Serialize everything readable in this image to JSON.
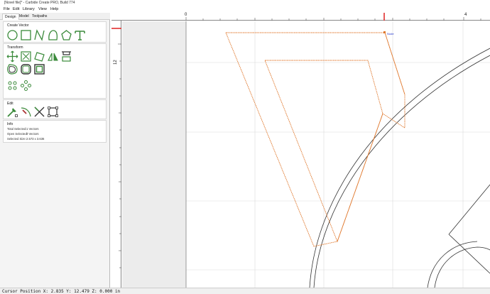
{
  "window": {
    "title": "[Novel file]* - Carbide Create PRO, Build 774"
  },
  "menu": [
    {
      "label": "File"
    },
    {
      "label": "Edit"
    },
    {
      "label": "Library"
    },
    {
      "label": "View"
    },
    {
      "label": "Help"
    }
  ],
  "tabs": [
    {
      "label": "Design",
      "active": true
    },
    {
      "label": "Model",
      "active": false
    },
    {
      "label": "Toolpaths",
      "active": false
    }
  ],
  "sections": {
    "create_vector": {
      "title": "Create Vector",
      "tools": [
        "circle-icon",
        "rectangle-icon",
        "polyline-icon",
        "curve-icon",
        "polygon-icon",
        "text-icon"
      ]
    },
    "transform": {
      "title": "Transform",
      "tools": [
        "move-icon",
        "scale-icon",
        "rotate-icon",
        "mirror-icon",
        "align-icon",
        "offset-icon",
        "fillet-icon",
        "boolean-icon",
        "circular-array-icon",
        "linear-array-icon"
      ]
    },
    "edit": {
      "title": "Edit",
      "tools": [
        "node-edit-icon",
        "knife-icon",
        "trim-icon",
        "bounding-box-icon"
      ]
    },
    "info": {
      "title": "Info",
      "rows": [
        {
          "label": "Total Selected:",
          "value": "1 Vectors"
        },
        {
          "label": "Open Selected:",
          "value": "0 Vectors"
        },
        {
          "label": "Selected Size:",
          "value": "2.573 x 3.636"
        }
      ]
    }
  },
  "rulers": {
    "top_labels": [
      "0",
      "4"
    ],
    "left_labels": [
      "12"
    ]
  },
  "canvas": {
    "node_label": "Node",
    "vector_color": "#e07a30",
    "outline_color": "#333333"
  },
  "status": {
    "text": "Cursor Position X: 2.835 Y: 12.479 Z: 0.000 in"
  }
}
